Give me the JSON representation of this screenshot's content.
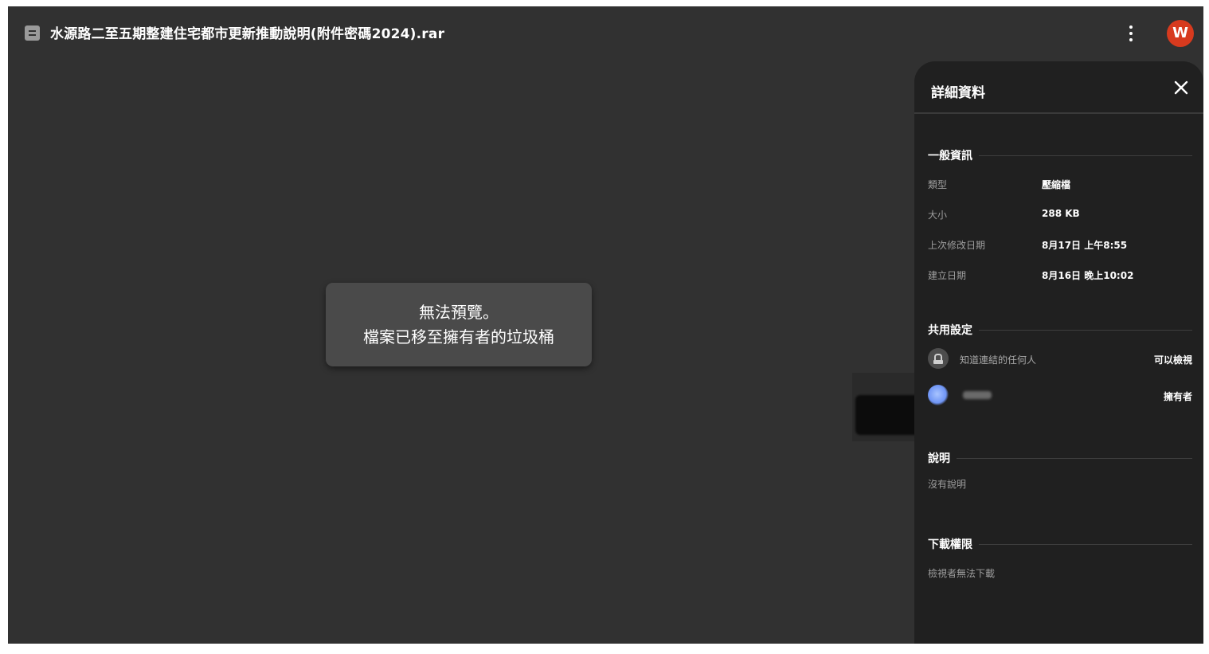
{
  "topbar": {
    "file_title": "水源路二至五期整建住宅都市更新推動說明(附件密碼2024).rar",
    "file_icon": "document-icon",
    "more_icon": "more-vert-icon",
    "avatar_letter": "W"
  },
  "preview": {
    "line1": "無法預覽。",
    "line2": "檔案已移至擁有者的垃圾桶"
  },
  "details": {
    "title": "詳細資料",
    "close_icon": "close-icon",
    "general": {
      "heading": "一般資訊",
      "rows": [
        {
          "label": "類型",
          "value": "壓縮檔"
        },
        {
          "label": "大小",
          "value": "288 KB"
        },
        {
          "label": "上次修改日期",
          "value": "8月17日 上午8:55"
        },
        {
          "label": "建立日期",
          "value": "8月16日 晚上10:02"
        }
      ]
    },
    "sharing": {
      "heading": "共用設定",
      "link_label": "知道連結的任何人",
      "link_role": "可以檢視",
      "owner_role": "擁有者"
    },
    "description": {
      "heading": "說明",
      "text": "沒有說明"
    },
    "download": {
      "heading": "下載權限",
      "text": "檢視者無法下載"
    }
  },
  "colors": {
    "background": "#313131",
    "panel": "#202020",
    "avatar": "#d73a1e"
  }
}
